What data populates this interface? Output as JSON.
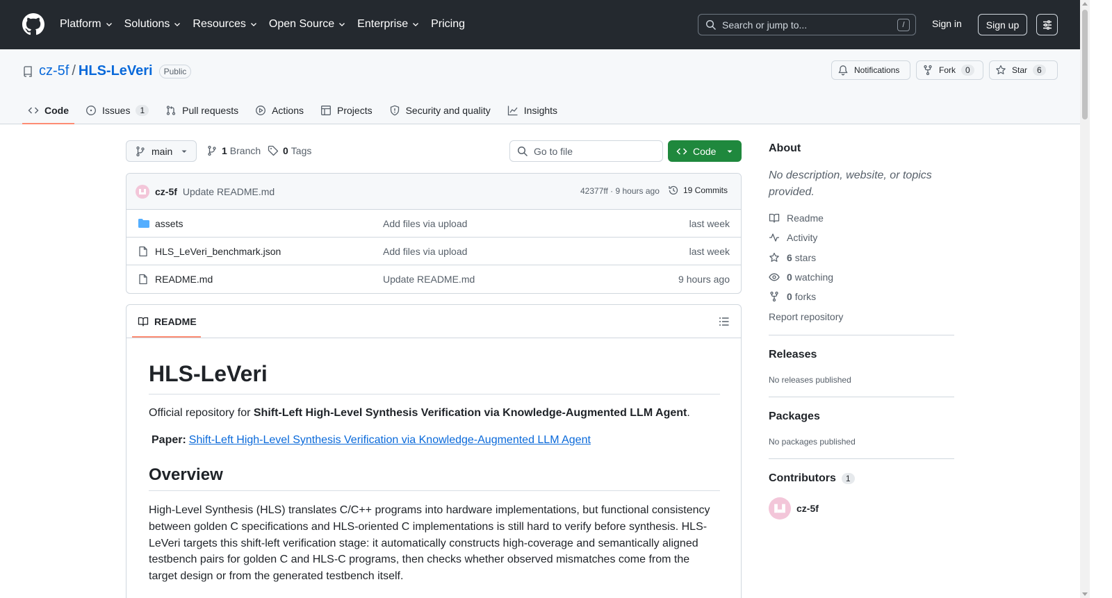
{
  "header": {
    "nav": [
      "Platform",
      "Solutions",
      "Resources",
      "Open Source",
      "Enterprise",
      "Pricing"
    ],
    "nav_dropdown": [
      true,
      true,
      true,
      true,
      true,
      false
    ],
    "search_placeholder": "Search or jump to...",
    "search_shortcut": "/",
    "sign_in": "Sign in",
    "sign_up": "Sign up"
  },
  "repo": {
    "owner": "cz-5f",
    "separator": "/",
    "name": "HLS-LeVeri",
    "visibility": "Public",
    "notifications_label": "Notifications",
    "fork_label": "Fork",
    "fork_count": "0",
    "star_label": "Star",
    "star_count": "6"
  },
  "tabs": [
    {
      "label": "Code",
      "icon": "code-icon"
    },
    {
      "label": "Issues",
      "icon": "issue-icon",
      "count": "1"
    },
    {
      "label": "Pull requests",
      "icon": "pull-request-icon"
    },
    {
      "label": "Actions",
      "icon": "play-icon"
    },
    {
      "label": "Projects",
      "icon": "table-icon"
    },
    {
      "label": "Security and quality",
      "icon": "shield-icon"
    },
    {
      "label": "Insights",
      "icon": "graph-icon"
    }
  ],
  "toolbar": {
    "branch": "main",
    "branch_count": "1",
    "branch_label": "Branch",
    "tag_count": "0",
    "tag_label": "Tags",
    "go_to_file": "Go to file",
    "code_button": "Code"
  },
  "latest_commit": {
    "author": "cz-5f",
    "message": "Update README.md",
    "meta": "42377ff · 9 hours ago",
    "commits": "19 Commits"
  },
  "files": [
    {
      "type": "folder",
      "name": "assets",
      "message": "Add files via upload",
      "date": "last week"
    },
    {
      "type": "file",
      "name": "HLS_LeVeri_benchmark.json",
      "message": "Add files via upload",
      "date": "last week"
    },
    {
      "type": "file",
      "name": "README.md",
      "message": "Update README.md",
      "date": "9 hours ago"
    }
  ],
  "readme": {
    "tab_label": "README",
    "title": "HLS-LeVeri",
    "intro_prefix": "Official repository for ",
    "intro_bold": "Shift-Left High-Level Synthesis Verification via Knowledge-Augmented LLM Agent",
    "intro_suffix": ".",
    "paper_glyph": "",
    "paper_label": "Paper:",
    "paper_link": "Shift-Left High-Level Synthesis Verification via Knowledge-Augmented LLM Agent",
    "overview_heading": "Overview",
    "overview_text": "High-Level Synthesis (HLS) translates C/C++ programs into hardware implementations, but functional consistency between golden C specifications and HLS-oriented C implementations is still hard to verify before synthesis. HLS-LeVeri targets this shift-left verification stage: it automatically constructs high-coverage and semantically aligned testbench pairs for golden C and HLS-C programs, then checks whether observed mismatches come from the target design or from the generated testbench itself."
  },
  "about": {
    "heading": "About",
    "description": "No description, website, or topics provided.",
    "readme": "Readme",
    "activity": "Activity",
    "stars_count": "6",
    "stars_label": "stars",
    "watching_count": "0",
    "watching_label": "watching",
    "forks_count": "0",
    "forks_label": "forks",
    "report": "Report repository"
  },
  "releases": {
    "heading": "Releases",
    "empty": "No releases published"
  },
  "packages": {
    "heading": "Packages",
    "empty": "No packages published"
  },
  "contributors": {
    "heading": "Contributors",
    "count": "1",
    "list": [
      "cz-5f"
    ]
  },
  "colors": {
    "header_bg": "#24292f",
    "link": "#0969da",
    "primary_button": "#1f883d",
    "tab_underline": "#fd8c73",
    "avatar": "#f3c6d9"
  }
}
